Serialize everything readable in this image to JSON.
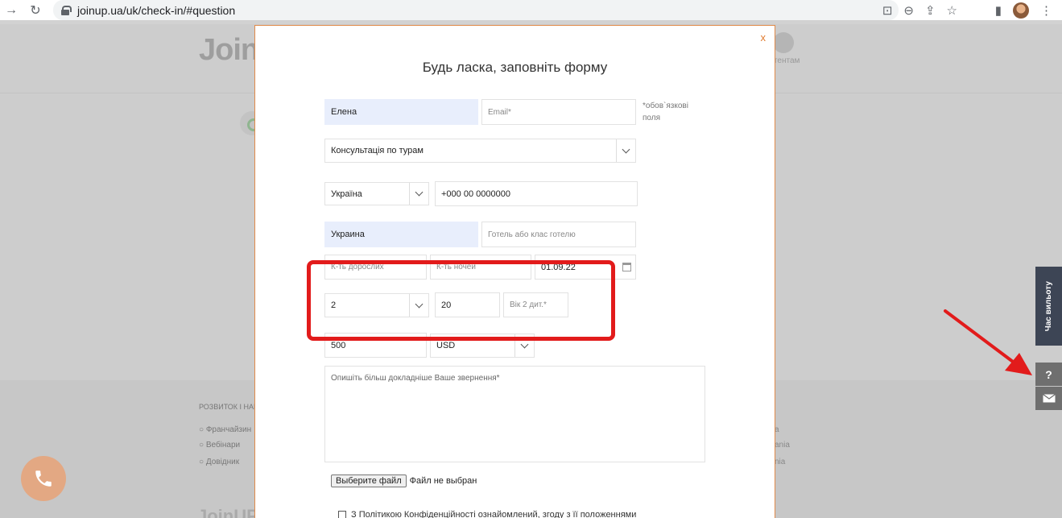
{
  "browser": {
    "url": "joinup.ua/uk/check-in/#question",
    "icons": [
      "forward-icon",
      "reload-icon",
      "lock-icon",
      "translate-icon",
      "zoom-icon",
      "share-icon",
      "star-icon",
      "sidebar-icon",
      "profile-avatar",
      "menu-icon"
    ]
  },
  "background_page": {
    "logo": "Join",
    "agent_label": "гентам",
    "footer_title": "РОЗВИТОК І НАВЧ",
    "footer_items": [
      "Франчайзин",
      "Вебінари",
      "Довідник"
    ],
    "right_fragments": [
      "а",
      "ania",
      "nia"
    ],
    "logo_bottom": "JoinUP"
  },
  "modal": {
    "close_label": "х",
    "title": "Будь ласка, заповніть форму",
    "required_note": "*обов`язкові поля",
    "name_value": "Елена",
    "email_placeholder": "Email*",
    "topic_value": "Консультація по турам",
    "country_code_value": "Україна",
    "phone_placeholder": "+000 00 0000000",
    "destination_value": "Украина",
    "hotel_placeholder": "Готель або клас готелю",
    "adults_placeholder": "К-ть дорослих",
    "nights_placeholder": "К-ть ночей",
    "date_value": "01.09.22",
    "children_value": "2",
    "child_age_1_value": "20",
    "child_age_2_placeholder": "Вік 2 дит.*",
    "budget_value": "500",
    "currency_value": "USD",
    "message_placeholder": "Опишіть більш докладніше Ваше звернення*",
    "file_button_label": "Выберите файл",
    "file_status": "Файл не выбран",
    "consent_text": "З Політикою Конфіденційності ознайомлений, згоду з її положеннями"
  },
  "side_widgets": {
    "time_tab_label": "Час вильоту",
    "help_label": "?",
    "mail_icon": "mail-icon"
  },
  "colors": {
    "modal_border": "#e08a4a",
    "close_color": "#e07b2f",
    "filled_field": "#e8eefc",
    "annotation_red": "#e21b1b",
    "side_tab": "#3d4555",
    "call_button": "#e3a883"
  }
}
